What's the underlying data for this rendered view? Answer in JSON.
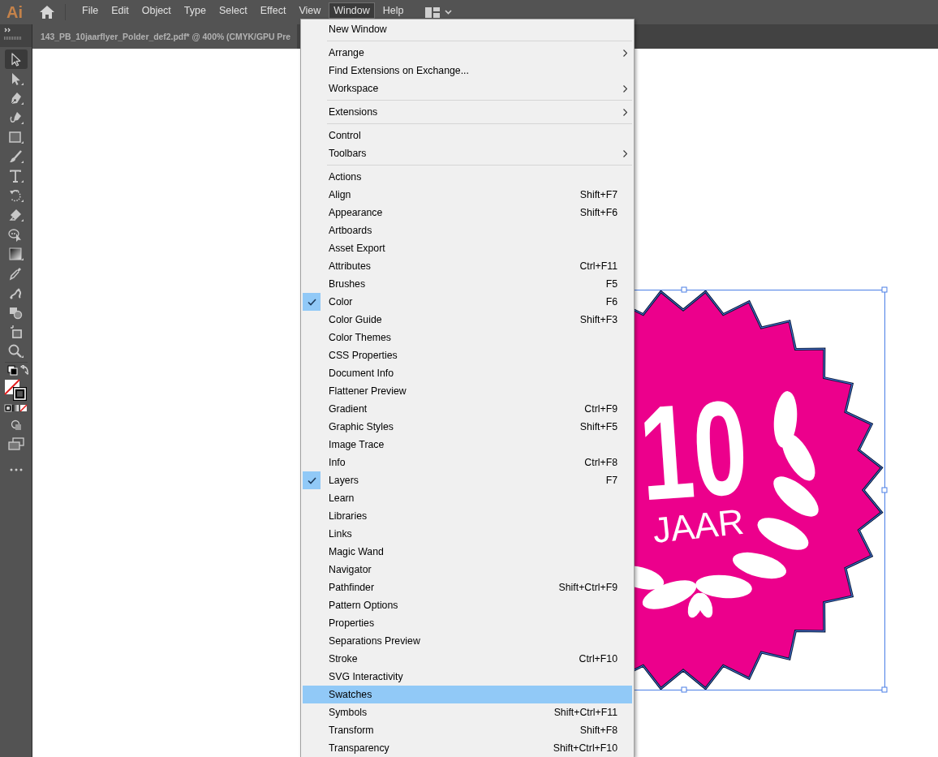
{
  "app": {
    "logo": "Ai"
  },
  "menubar": [
    {
      "label": "File",
      "selected": false
    },
    {
      "label": "Edit",
      "selected": false
    },
    {
      "label": "Object",
      "selected": false
    },
    {
      "label": "Type",
      "selected": false
    },
    {
      "label": "Select",
      "selected": false
    },
    {
      "label": "Effect",
      "selected": false
    },
    {
      "label": "View",
      "selected": false
    },
    {
      "label": "Window",
      "selected": true
    },
    {
      "label": "Help",
      "selected": false
    }
  ],
  "document_tab": {
    "title": "143_PB_10jaarflyer_Polder_def2.pdf* @ 400% (CMYK/GPU Pre"
  },
  "tools": [
    {
      "kind": "selection",
      "selected": true
    },
    {
      "kind": "direct-selection",
      "selected": false
    },
    {
      "kind": "pen",
      "selected": false
    },
    {
      "kind": "curvature",
      "selected": false
    },
    {
      "kind": "rectangle",
      "selected": false
    },
    {
      "kind": "paintbrush",
      "selected": false
    },
    {
      "kind": "type",
      "selected": false
    },
    {
      "kind": "rotate",
      "selected": false
    },
    {
      "kind": "eraser",
      "selected": false
    },
    {
      "kind": "shape-builder",
      "selected": false
    },
    {
      "kind": "gradient",
      "selected": false
    },
    {
      "kind": "eyedropper",
      "selected": false
    },
    {
      "kind": "puppet-warp",
      "selected": false
    },
    {
      "kind": "live-paint",
      "selected": false
    },
    {
      "kind": "artboard",
      "selected": false
    },
    {
      "kind": "zoom",
      "selected": false
    }
  ],
  "artwork": {
    "number": "10",
    "label": "JAAR"
  },
  "window_menu": {
    "sections": [
      [
        {
          "label": "New Window",
          "submenu": false,
          "checked": false,
          "selected": false
        }
      ],
      [
        {
          "label": "Arrange",
          "submenu": true,
          "checked": false,
          "selected": false
        },
        {
          "label": "Find Extensions on Exchange...",
          "submenu": false,
          "checked": false,
          "selected": false
        },
        {
          "label": "Workspace",
          "submenu": true,
          "checked": false,
          "selected": false
        }
      ],
      [
        {
          "label": "Extensions",
          "submenu": true,
          "checked": false,
          "selected": false
        }
      ],
      [
        {
          "label": "Control",
          "submenu": false,
          "checked": false,
          "selected": false
        },
        {
          "label": "Toolbars",
          "submenu": true,
          "checked": false,
          "selected": false
        }
      ],
      [
        {
          "label": "Actions",
          "submenu": false,
          "checked": false,
          "selected": false
        },
        {
          "label": "Align",
          "shortcut": "Shift+F7",
          "submenu": false,
          "checked": false,
          "selected": false
        },
        {
          "label": "Appearance",
          "shortcut": "Shift+F6",
          "submenu": false,
          "checked": false,
          "selected": false
        },
        {
          "label": "Artboards",
          "submenu": false,
          "checked": false,
          "selected": false
        },
        {
          "label": "Asset Export",
          "submenu": false,
          "checked": false,
          "selected": false
        },
        {
          "label": "Attributes",
          "shortcut": "Ctrl+F11",
          "submenu": false,
          "checked": false,
          "selected": false
        },
        {
          "label": "Brushes",
          "shortcut": "F5",
          "submenu": false,
          "checked": false,
          "selected": false
        },
        {
          "label": "Color",
          "shortcut": "F6",
          "submenu": false,
          "checked": true,
          "selected": false
        },
        {
          "label": "Color Guide",
          "shortcut": "Shift+F3",
          "submenu": false,
          "checked": false,
          "selected": false
        },
        {
          "label": "Color Themes",
          "submenu": false,
          "checked": false,
          "selected": false
        },
        {
          "label": "CSS Properties",
          "submenu": false,
          "checked": false,
          "selected": false
        },
        {
          "label": "Document Info",
          "submenu": false,
          "checked": false,
          "selected": false
        },
        {
          "label": "Flattener Preview",
          "submenu": false,
          "checked": false,
          "selected": false
        },
        {
          "label": "Gradient",
          "shortcut": "Ctrl+F9",
          "submenu": false,
          "checked": false,
          "selected": false
        },
        {
          "label": "Graphic Styles",
          "shortcut": "Shift+F5",
          "submenu": false,
          "checked": false,
          "selected": false
        },
        {
          "label": "Image Trace",
          "submenu": false,
          "checked": false,
          "selected": false
        },
        {
          "label": "Info",
          "shortcut": "Ctrl+F8",
          "submenu": false,
          "checked": false,
          "selected": false
        },
        {
          "label": "Layers",
          "shortcut": "F7",
          "submenu": false,
          "checked": true,
          "selected": false
        },
        {
          "label": "Learn",
          "submenu": false,
          "checked": false,
          "selected": false
        },
        {
          "label": "Libraries",
          "submenu": false,
          "checked": false,
          "selected": false
        },
        {
          "label": "Links",
          "submenu": false,
          "checked": false,
          "selected": false
        },
        {
          "label": "Magic Wand",
          "submenu": false,
          "checked": false,
          "selected": false
        },
        {
          "label": "Navigator",
          "submenu": false,
          "checked": false,
          "selected": false
        },
        {
          "label": "Pathfinder",
          "shortcut": "Shift+Ctrl+F9",
          "submenu": false,
          "checked": false,
          "selected": false
        },
        {
          "label": "Pattern Options",
          "submenu": false,
          "checked": false,
          "selected": false
        },
        {
          "label": "Properties",
          "submenu": false,
          "checked": false,
          "selected": false
        },
        {
          "label": "Separations Preview",
          "submenu": false,
          "checked": false,
          "selected": false
        },
        {
          "label": "Stroke",
          "shortcut": "Ctrl+F10",
          "submenu": false,
          "checked": false,
          "selected": false
        },
        {
          "label": "SVG Interactivity",
          "submenu": false,
          "checked": false,
          "selected": false
        },
        {
          "label": "Swatches",
          "submenu": false,
          "checked": false,
          "selected": true
        },
        {
          "label": "Symbols",
          "shortcut": "Shift+Ctrl+F11",
          "submenu": false,
          "checked": false,
          "selected": false
        },
        {
          "label": "Transform",
          "shortcut": "Shift+F8",
          "submenu": false,
          "checked": false,
          "selected": false
        },
        {
          "label": "Transparency",
          "shortcut": "Shift+Ctrl+F10",
          "submenu": false,
          "checked": false,
          "selected": false
        }
      ]
    ]
  }
}
